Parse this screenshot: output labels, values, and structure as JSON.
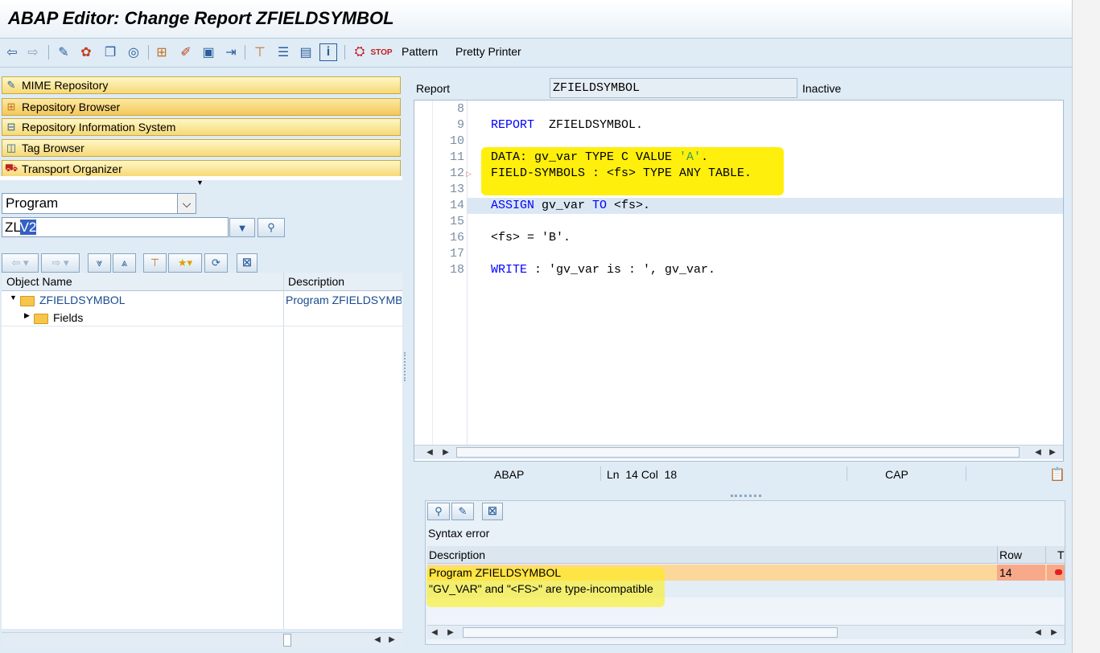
{
  "window": {
    "title": "ABAP Editor: Change Report ZFIELDSYMBOL"
  },
  "toolbar": {
    "icons": [
      "back-arrow-icon",
      "forward-arrow-icon",
      "glasses-pencil-icon",
      "check-icon",
      "activate-icon",
      "test-icon",
      "object-list-icon",
      "where-used-icon",
      "hierarchy-icon",
      "wand-icon",
      "enhance-icon",
      "stack-icon",
      "info-icon",
      "debug-icon",
      "stop-icon"
    ],
    "pattern_label": "Pattern",
    "pretty_printer_label": "Pretty Printer"
  },
  "navigator": {
    "items": [
      {
        "label": "MIME Repository",
        "icon": "mime-icon"
      },
      {
        "label": "Repository Browser",
        "icon": "repository-icon"
      },
      {
        "label": "Repository Information System",
        "icon": "info-system-icon"
      },
      {
        "label": "Tag Browser",
        "icon": "tag-icon"
      },
      {
        "label": "Transport Organizer",
        "icon": "truck-icon"
      }
    ],
    "object_type": "Program",
    "object_name_prefix": "ZL",
    "object_name_selected": "V2",
    "tree_columns": [
      "Object Name",
      "Description"
    ],
    "tree_rows": [
      {
        "name": "ZFIELDSYMBOL",
        "description": "Program ZFIELDSYMB"
      },
      {
        "name": "Fields",
        "description": ""
      }
    ]
  },
  "editor": {
    "type_label": "Report",
    "program_name": "ZFIELDSYMBOL",
    "status": "Inactive",
    "line_numbers": [
      "8",
      "9",
      "10",
      "11",
      "12",
      "13",
      "14",
      "15",
      "16",
      "17",
      "18"
    ],
    "code": {
      "l9_kw": "REPORT",
      "l9_rest": "  ZFIELDSYMBOL.",
      "l11_a": "DATA: gv_var TYPE C VALUE ",
      "l11_str": "'A'",
      "l11_end": ".",
      "l12": "FIELD-SYMBOLS : <fs> TYPE ANY TABLE.",
      "l14_kw1": "ASSIGN",
      "l14_mid": " gv_var ",
      "l14_kw2": "TO",
      "l14_end": " <fs>.",
      "l16": "<fs> = 'B'.",
      "l18_kw": "WRITE",
      "l18_rest": " : 'gv_var is : ', gv_var."
    }
  },
  "status": {
    "language": "ABAP",
    "position": "Ln  14 Col  18",
    "caps": "CAP"
  },
  "errors": {
    "title": "Syntax error",
    "columns": [
      "Description",
      "Row",
      "T"
    ],
    "program_row": "Program ZFIELDSYMBOL",
    "row_value": "14",
    "message": "\"GV_VAR\" and \"<FS>\" are type-incompatible"
  },
  "colors": {
    "highlight": "#ffee00",
    "nav_button": "#f6d977",
    "error_row": "#fcd79a",
    "keyword": "#0000ff"
  }
}
